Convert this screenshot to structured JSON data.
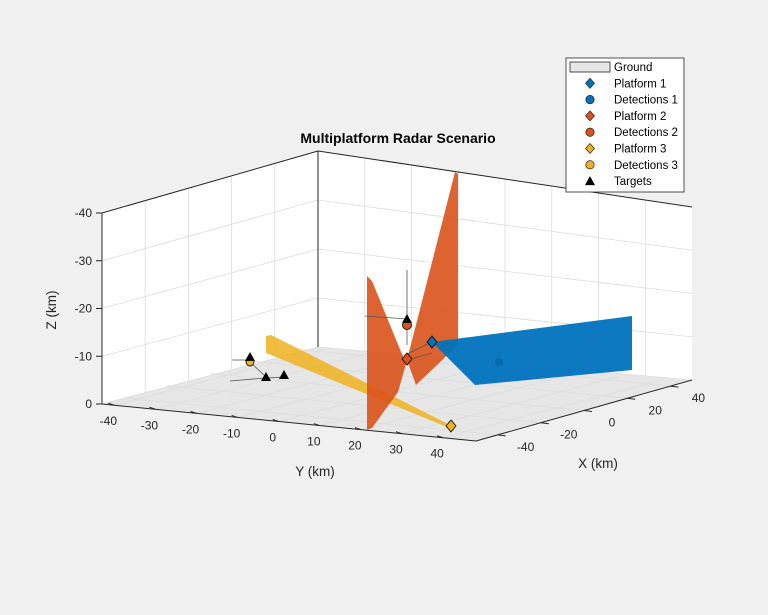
{
  "chart_data": {
    "type": "scatter3d",
    "title": "Multiplatform Radar Scenario",
    "xlabel": "X (km)",
    "ylabel": "Y (km)",
    "zlabel": "Z (km)",
    "xlim": [
      -50,
      50
    ],
    "ylim": [
      -40,
      50
    ],
    "zlim": [
      -40,
      0
    ],
    "z_direction": "reverse",
    "grid": true,
    "legend_position": "top-right",
    "x_ticks": [
      "-40",
      "-20",
      "0",
      "20",
      "40"
    ],
    "y_ticks": [
      "-40",
      "-30",
      "-20",
      "-10",
      "0",
      "10",
      "20",
      "30",
      "40"
    ],
    "z_ticks": [
      "-40",
      "-30",
      "-20",
      "-10",
      "0"
    ],
    "legend": [
      {
        "label": "Ground",
        "marker": "rect",
        "color": "#e6e6e6"
      },
      {
        "label": "Platform 1",
        "marker": "diamond",
        "color": "#0072bd"
      },
      {
        "label": "Detections 1",
        "marker": "circle",
        "color": "#0072bd"
      },
      {
        "label": "Platform 2",
        "marker": "diamond",
        "color": "#d95319"
      },
      {
        "label": "Detections 2",
        "marker": "circle",
        "color": "#d95319"
      },
      {
        "label": "Platform 3",
        "marker": "diamond",
        "color": "#edb120"
      },
      {
        "label": "Detections 3",
        "marker": "circle",
        "color": "#edb120"
      },
      {
        "label": "Targets",
        "marker": "triangle",
        "color": "#000000"
      }
    ],
    "series": [
      {
        "name": "Platform 1",
        "points": [
          {
            "x": 10,
            "y": 30,
            "z": -5
          }
        ]
      },
      {
        "name": "Detections 1",
        "points": [
          {
            "x": 0,
            "y": 40,
            "z": -4
          }
        ]
      },
      {
        "name": "Platform 2",
        "points": [
          {
            "x": 10,
            "y": 25,
            "z": 0
          }
        ]
      },
      {
        "name": "Detections 2",
        "points": [
          {
            "x": 15,
            "y": 15,
            "z": -15
          }
        ]
      },
      {
        "name": "Platform 3",
        "points": [
          {
            "x": -40,
            "y": 45,
            "z": 0
          }
        ]
      },
      {
        "name": "Detections 3",
        "points": [
          {
            "x": 10,
            "y": -30,
            "z": 0
          }
        ]
      },
      {
        "name": "Targets",
        "points": [
          {
            "x": 15,
            "y": 15,
            "z": -15
          },
          {
            "x": 10,
            "y": -30,
            "z": 0
          },
          {
            "x": 0,
            "y": -22,
            "z": 0
          },
          {
            "x": 0,
            "y": -17,
            "z": 0
          }
        ]
      }
    ]
  }
}
